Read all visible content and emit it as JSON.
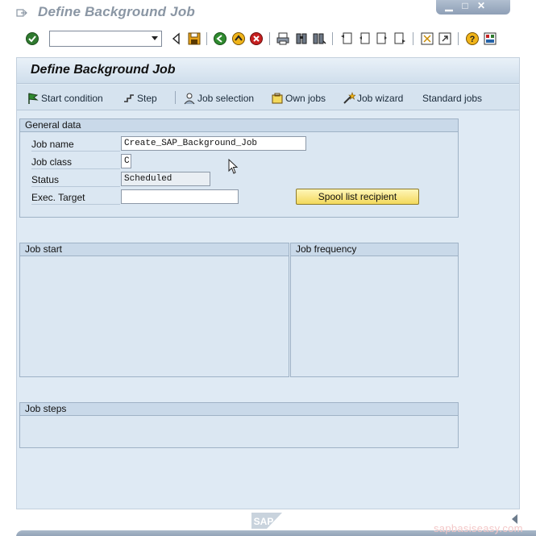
{
  "window": {
    "title": "Define Background Job"
  },
  "toolbar": {
    "command_field_value": "",
    "icons": [
      "enter-check-icon",
      "back-icon",
      "save-icon",
      "back-green-icon",
      "exit-icon",
      "cancel-icon",
      "print-icon",
      "find-icon",
      "find-next-icon",
      "first-page-icon",
      "previous-page-icon",
      "next-page-icon",
      "last-page-icon",
      "create-session-icon",
      "shortcut-icon",
      "help-icon",
      "layout-icon"
    ]
  },
  "screen": {
    "title": "Define Background Job"
  },
  "appbar": {
    "start_condition": "Start condition",
    "step": "Step",
    "job_selection": "Job selection",
    "own_jobs": "Own jobs",
    "job_wizard": "Job wizard",
    "standard_jobs": "Standard jobs"
  },
  "general_data": {
    "heading": "General data",
    "job_name_label": "Job name",
    "job_name_value": "Create_SAP_Background_Job",
    "job_class_label": "Job class",
    "job_class_value": "C",
    "status_label": "Status",
    "status_value": "Scheduled",
    "exec_target_label": "Exec. Target",
    "exec_target_value": "",
    "spool_button": "Spool list recipient"
  },
  "job_start": {
    "heading": "Job start"
  },
  "job_frequency": {
    "heading": "Job frequency"
  },
  "job_steps": {
    "heading": "Job steps"
  },
  "footer": {
    "logo_text": "SAP",
    "watermark": "sapbasiseasy.com"
  },
  "colors": {
    "panel_bg": "#dfeaf4",
    "spool_button": "#f3d95c",
    "title_gray": "#8a96a4"
  }
}
